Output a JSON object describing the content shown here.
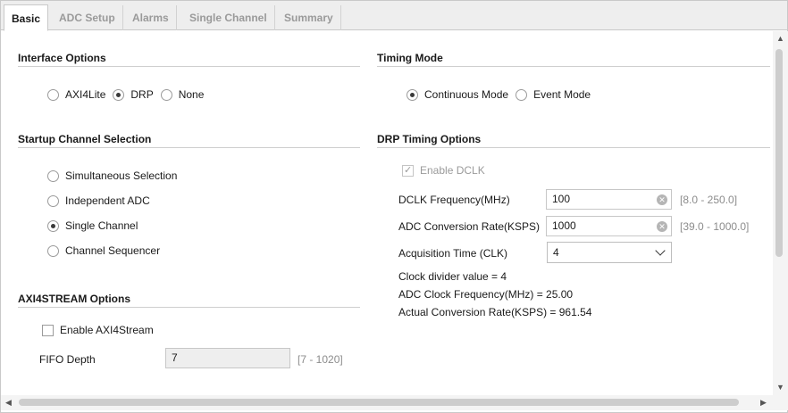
{
  "tabs": [
    {
      "label": "Basic"
    },
    {
      "label": "ADC Setup"
    },
    {
      "label": "Alarms"
    },
    {
      "label": "Single Channel"
    },
    {
      "label": "Summary"
    }
  ],
  "interface_options": {
    "title": "Interface Options",
    "options": [
      "AXI4Lite",
      "DRP",
      "None"
    ],
    "selected": "DRP"
  },
  "timing_mode": {
    "title": "Timing Mode",
    "options": [
      "Continuous Mode",
      "Event Mode"
    ],
    "selected": "Continuous Mode"
  },
  "startup_channel": {
    "title": "Startup Channel Selection",
    "options": [
      "Simultaneous Selection",
      "Independent ADC",
      "Single Channel",
      "Channel Sequencer"
    ],
    "selected": "Single Channel"
  },
  "drp_timing": {
    "title": "DRP Timing Options",
    "enable_dclk_label": "Enable DCLK",
    "dclk_freq_label": "DCLK Frequency(MHz)",
    "dclk_freq_value": "100",
    "dclk_freq_range": "[8.0 - 250.0]",
    "adc_rate_label": "ADC Conversion Rate(KSPS)",
    "adc_rate_value": "1000",
    "adc_rate_range": "[39.0 - 1000.0]",
    "acq_time_label": "Acquisition Time (CLK)",
    "acq_time_value": "4",
    "clock_divider": "Clock divider value = 4",
    "adc_clock_freq": "ADC Clock Frequency(MHz) = 25.00",
    "actual_rate": "Actual Conversion Rate(KSPS) = 961.54"
  },
  "axi4stream": {
    "title": "AXI4STREAM Options",
    "enable_label": "Enable AXI4Stream",
    "fifo_label": "FIFO Depth",
    "fifo_value": "7",
    "fifo_range": "[7 - 1020]"
  },
  "icons": {
    "clear": "clear-icon",
    "dropdown": "chevron-down-icon"
  },
  "scroll_arrows": {
    "up": "▲",
    "down": "▼",
    "left": "◀",
    "right": "▶"
  }
}
